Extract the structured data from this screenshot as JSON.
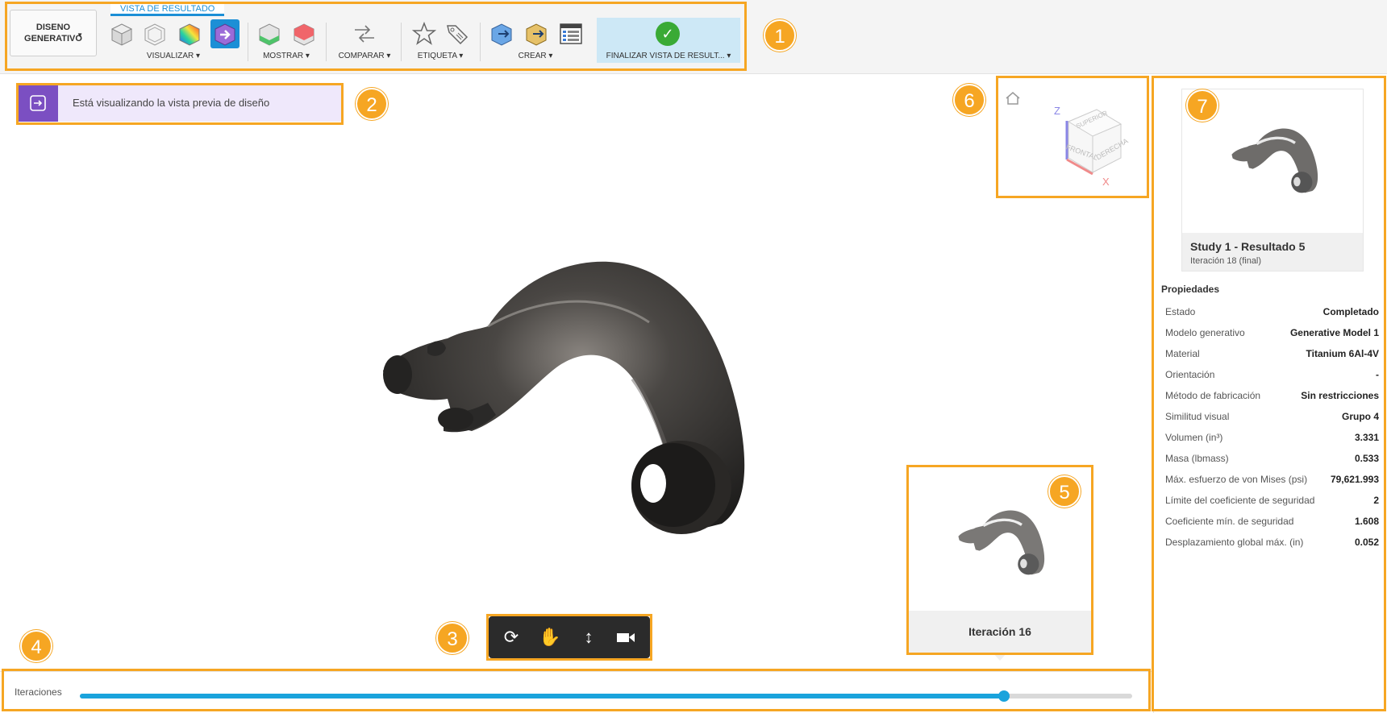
{
  "toolbar": {
    "workspace_label_line1": "DISENO",
    "workspace_label_line2": "GENERATIVO",
    "tab_label": "VISTA DE RESULTADO",
    "groups": {
      "visualizar": "VISUALIZAR ▾",
      "mostrar": "MOSTRAR ▾",
      "comparar": "COMPARAR ▾",
      "etiqueta": "ETIQUETA ▾",
      "crear": "CREAR ▾",
      "finalizar": "FINALIZAR VISTA DE RESULT... ▾"
    }
  },
  "badges": [
    "1",
    "2",
    "3",
    "4",
    "5",
    "6",
    "7"
  ],
  "banner": {
    "text": "Está visualizando la vista previa de diseño"
  },
  "viewcube": {
    "axis_z": "Z",
    "axis_x": "X",
    "face_top": "SUPERIOR",
    "face_front": "FRONTAL",
    "face_right": "DERECHA"
  },
  "result": {
    "title": "Study 1 - Resultado 5",
    "subtitle": "Iteración 18 (final)"
  },
  "properties": {
    "header": "Propiedades",
    "rows": [
      {
        "key": "Estado",
        "value": "Completado"
      },
      {
        "key": "Modelo generativo",
        "value": "Generative Model 1"
      },
      {
        "key": "Material",
        "value": "Titanium 6Al-4V"
      },
      {
        "key": "Orientación",
        "value": "-"
      },
      {
        "key": "Método de fabricación",
        "value": "Sin restricciones"
      },
      {
        "key": "Similitud visual",
        "value": "Grupo 4"
      },
      {
        "key": "Volumen (in³)",
        "value": "3.331"
      },
      {
        "key": "Masa (lbmass)",
        "value": "0.533"
      },
      {
        "key": "Máx. esfuerzo de von Mises (psi)",
        "value": "79,621.993"
      },
      {
        "key": "Límite del coeficiente de seguridad",
        "value": "2"
      },
      {
        "key": "Coeficiente mín. de seguridad",
        "value": "1.608"
      },
      {
        "key": "Desplazamiento global máx. (in)",
        "value": "0.052"
      }
    ]
  },
  "iteration_card": {
    "label": "Iteración 16"
  },
  "timeline": {
    "label": "Iteraciones",
    "ticks": [
      "10",
      "16",
      "18"
    ],
    "current": 16,
    "max": 18,
    "progress": 0.878
  },
  "colors": {
    "highlight": "#f6a623",
    "accent": "#1aa3dc",
    "banner_bg": "#efe8fb",
    "banner_icon": "#7b4fc2",
    "finalize_bg": "#cde8f6",
    "check": "#3aaa35"
  },
  "icons": {
    "navbar": [
      "orbit-icon",
      "pan-icon",
      "zoom-icon",
      "camera-icon"
    ],
    "home": "home-icon"
  }
}
